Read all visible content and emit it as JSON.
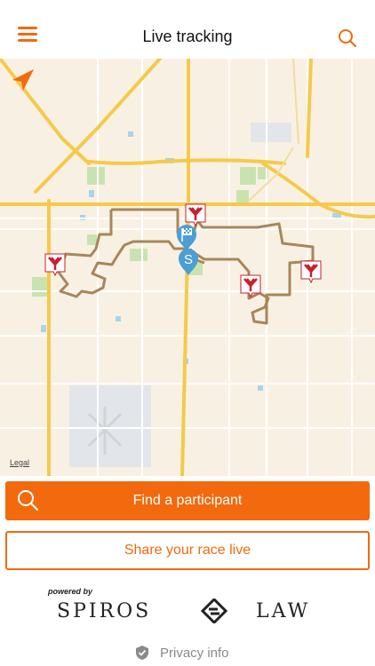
{
  "header": {
    "title": "Live tracking",
    "menu_icon": "hamburger-menu-icon",
    "search_icon": "search-icon"
  },
  "map": {
    "legal_label": "Legal",
    "markers": [
      "start-marker",
      "finish-flag-marker",
      "aid-station-marker",
      "aid-station-marker",
      "aid-station-marker",
      "aid-station-marker"
    ],
    "route_color": "#a8865a",
    "location_arrow_icon": "location-arrow-icon"
  },
  "actions": {
    "find_label": "Find a participant",
    "share_label": "Share your race live"
  },
  "sponsor": {
    "powered_by": "powered by",
    "name_left": "SPIROS",
    "name_right": "LAW"
  },
  "footer": {
    "privacy_label": "Privacy info"
  },
  "colors": {
    "accent": "#f26a0d",
    "map_bg": "#f8f1e3",
    "highway": "#f6c94a",
    "park": "#c9e3b0",
    "water": "#a8d4ec",
    "marker_red": "#c9202e",
    "marker_blue": "#4a9fd4"
  }
}
